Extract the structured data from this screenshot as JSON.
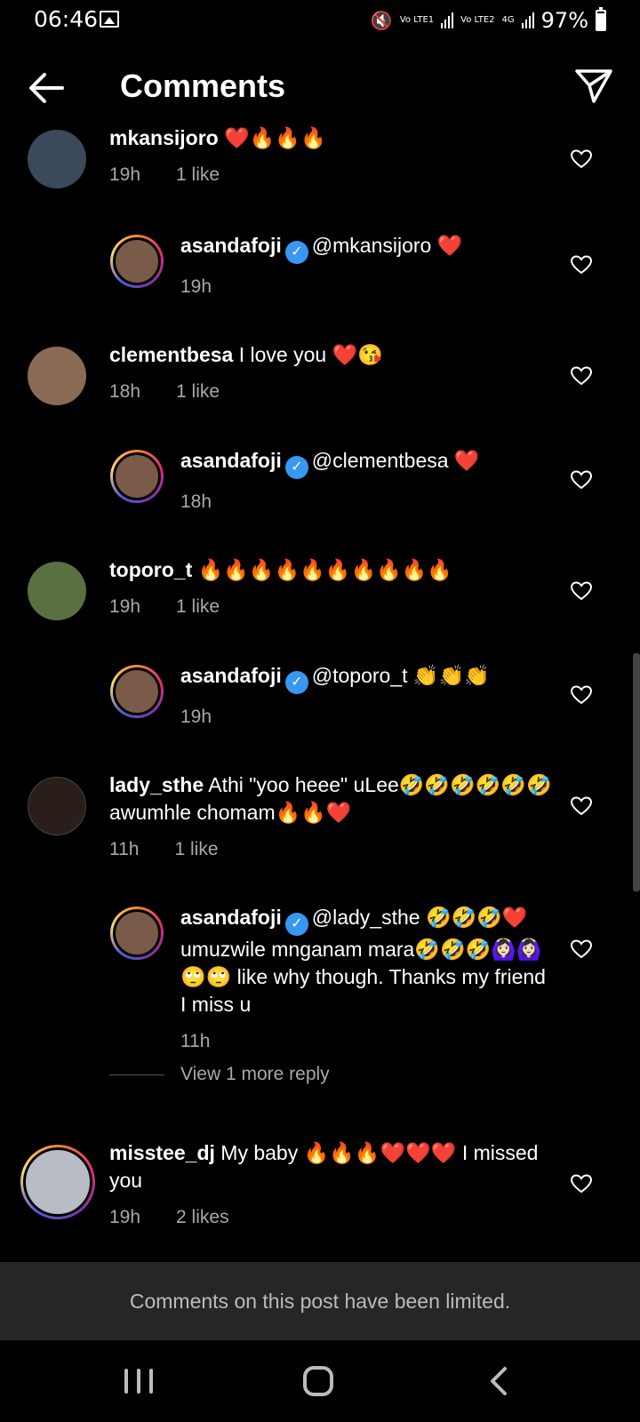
{
  "status_bar": {
    "time": "06:46",
    "sim1": "Vo LTE1",
    "sim2": "Vo LTE2",
    "network": "4G",
    "battery": "97%"
  },
  "header": {
    "title": "Comments"
  },
  "comments": [
    {
      "username": "mkansijoro",
      "text": "❤️🔥🔥🔥",
      "time": "19h",
      "likes": "1 like",
      "avatar_color": "#3a4a5a"
    },
    {
      "username": "asandafoji",
      "text": "@mkansijoro ❤️",
      "time": "19h"
    },
    {
      "username": "clementbesa",
      "text": "I love you ❤️😘",
      "time": "18h",
      "likes": "1 like",
      "avatar_color": "#8a6a55"
    },
    {
      "username": "asandafoji",
      "text": "@clementbesa ❤️",
      "time": "18h"
    },
    {
      "username": "toporo_t",
      "text": "🔥🔥🔥🔥🔥🔥🔥🔥🔥🔥",
      "time": "19h",
      "likes": "1 like",
      "avatar_color": "#5a7040"
    },
    {
      "username": "asandafoji",
      "text": "@toporo_t 👏👏👏",
      "time": "19h"
    },
    {
      "username": "lady_sthe",
      "text": "Athi \"yoo heee\" uLee🤣🤣🤣🤣🤣🤣awumhle chomam🔥🔥❤️",
      "time": "11h",
      "likes": "1 like",
      "avatar_color": "#2a1e1a"
    },
    {
      "username": "asandafoji",
      "text": "@lady_sthe 🤣🤣🤣❤️ umuzwile mnganam mara🤣🤣🤣🙆🏻‍♀️🙆🏻‍♀️🙄🙄 like why though. Thanks my friend I miss u",
      "time": "11h"
    },
    {
      "username": "misstee_dj",
      "text": "My baby 🔥🔥🔥❤️❤️❤️ I missed you",
      "time": "19h",
      "likes": "2 likes",
      "avatar_color": "#b8bcc4"
    }
  ],
  "reply_avatar_color": "#7a5a48",
  "view_more": "View 1 more reply",
  "limited_notice": "Comments on this post have been limited."
}
